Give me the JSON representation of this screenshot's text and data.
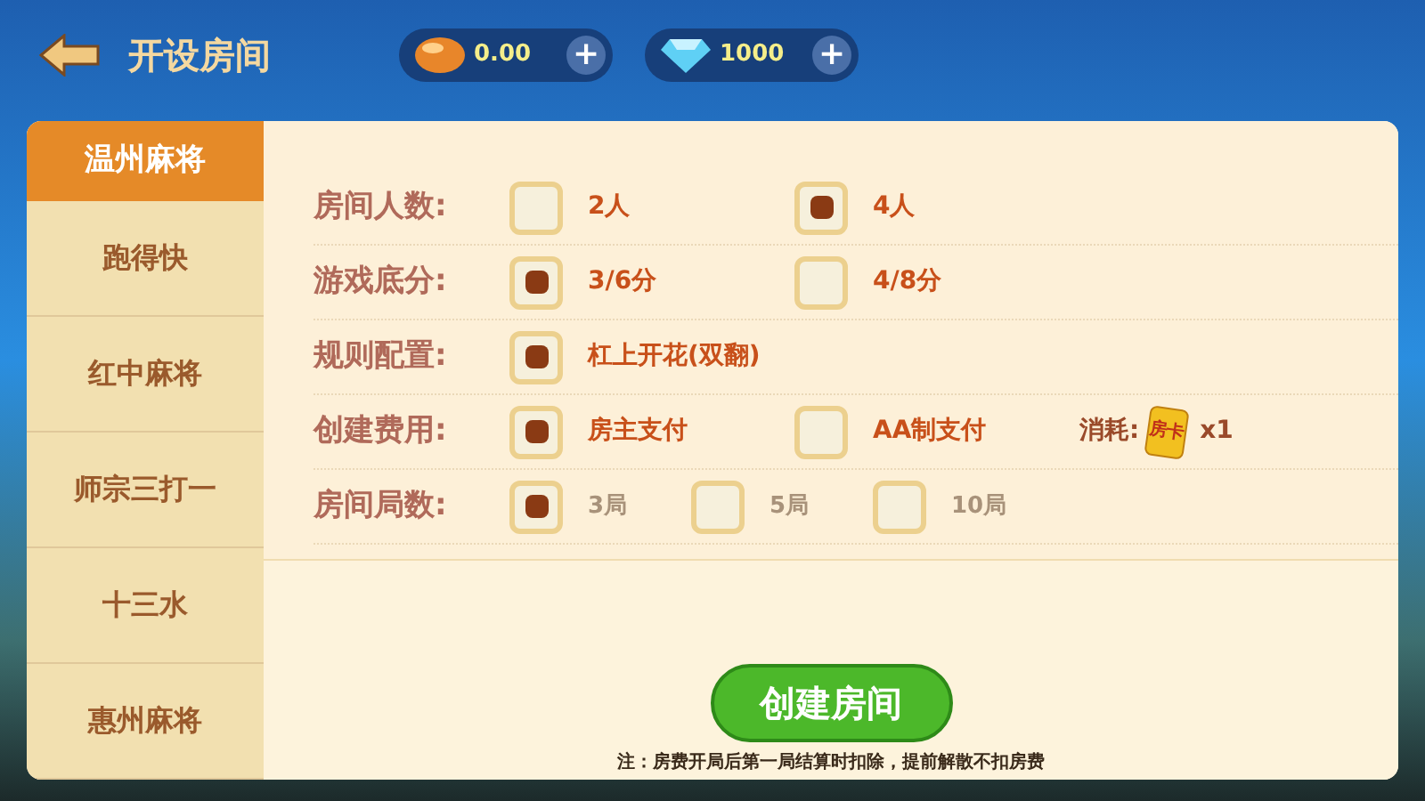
{
  "header": {
    "title": "开设房间",
    "currencies": [
      {
        "kind": "bean",
        "amount": "0.00",
        "add": "+"
      },
      {
        "kind": "diamond",
        "amount": "1000",
        "add": "+"
      }
    ]
  },
  "sidebar": {
    "items": [
      {
        "label": "温州麻将",
        "selected": true
      },
      {
        "label": "跑得快",
        "selected": false
      },
      {
        "label": "红中麻将",
        "selected": false
      },
      {
        "label": "师宗三打一",
        "selected": false
      },
      {
        "label": "十三水",
        "selected": false
      },
      {
        "label": "惠州麻将",
        "selected": false
      }
    ]
  },
  "settings": [
    {
      "label": "房间人数:",
      "options": [
        {
          "label": "2人",
          "checked": false,
          "disabled": false
        },
        {
          "label": "4人",
          "checked": true,
          "disabled": false
        }
      ]
    },
    {
      "label": "游戏底分:",
      "options": [
        {
          "label": "3/6分",
          "checked": true,
          "disabled": false
        },
        {
          "label": "4/8分",
          "checked": false,
          "disabled": false
        }
      ]
    },
    {
      "label": "规则配置:",
      "options": [
        {
          "label": "杠上开花(双翻)",
          "checked": true,
          "disabled": false
        }
      ]
    },
    {
      "label": "创建费用:",
      "options": [
        {
          "label": "房主支付",
          "checked": true,
          "disabled": false
        },
        {
          "label": "AA制支付",
          "checked": false,
          "disabled": false
        }
      ],
      "cost": {
        "label": "消耗:",
        "card": "房卡",
        "count": "x1"
      }
    },
    {
      "label": "房间局数:",
      "options": [
        {
          "label": "3局",
          "checked": true,
          "disabled": true
        },
        {
          "label": "5局",
          "checked": false,
          "disabled": true
        },
        {
          "label": "10局",
          "checked": false,
          "disabled": true
        }
      ]
    }
  ],
  "create_button": "创建房间",
  "note": "注：房费开局后第一局结算时扣除，提前解散不扣房费"
}
